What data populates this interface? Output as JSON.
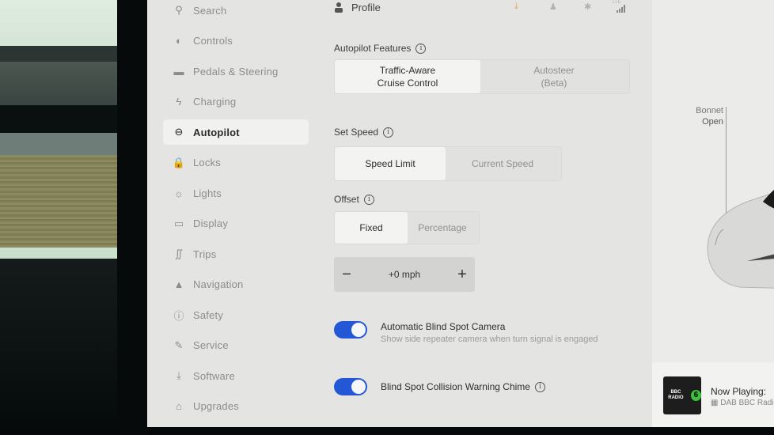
{
  "sidebar": {
    "items": [
      {
        "label": "Search",
        "icon": "search-icon",
        "glyph": "⚲"
      },
      {
        "label": "Controls",
        "icon": "toggle-icon",
        "glyph": "◐"
      },
      {
        "label": "Pedals & Steering",
        "icon": "car-icon",
        "glyph": "▬"
      },
      {
        "label": "Charging",
        "icon": "lightning-icon",
        "glyph": "ϟ"
      },
      {
        "label": "Autopilot",
        "icon": "steering-wheel-icon",
        "glyph": "⊖",
        "active": true
      },
      {
        "label": "Locks",
        "icon": "lock-icon",
        "glyph": "🔒"
      },
      {
        "label": "Lights",
        "icon": "light-icon",
        "glyph": "☼"
      },
      {
        "label": "Display",
        "icon": "display-icon",
        "glyph": "▭"
      },
      {
        "label": "Trips",
        "icon": "trips-icon",
        "glyph": "∬"
      },
      {
        "label": "Navigation",
        "icon": "navigation-icon",
        "glyph": "▲"
      },
      {
        "label": "Safety",
        "icon": "safety-icon",
        "glyph": "ⓘ"
      },
      {
        "label": "Service",
        "icon": "wrench-icon",
        "glyph": "✎"
      },
      {
        "label": "Software",
        "icon": "download-icon",
        "glyph": "⤓"
      },
      {
        "label": "Upgrades",
        "icon": "bag-icon",
        "glyph": "⌂"
      }
    ]
  },
  "header": {
    "profile_label": "Profile",
    "status_icons": [
      "download-icon",
      "bell-icon",
      "bluetooth-icon",
      "lte-signal-icon"
    ],
    "lte_label": "LTE"
  },
  "autopilot_features": {
    "label": "Autopilot Features",
    "options": [
      "Traffic-Aware\nCruise Control",
      "Autosteer\n(Beta)"
    ],
    "selected": 0
  },
  "set_speed": {
    "label": "Set Speed",
    "options": [
      "Speed Limit",
      "Current Speed"
    ],
    "selected": 0
  },
  "offset": {
    "label": "Offset",
    "options": [
      "Fixed",
      "Percentage"
    ],
    "selected": 0,
    "minus": "−",
    "plus": "+",
    "value": "+0 mph"
  },
  "toggles": [
    {
      "title": "Automatic Blind Spot Camera",
      "description": "Show side repeater camera when turn signal is engaged",
      "on": true
    },
    {
      "title": "Blind Spot Collision Warning Chime",
      "description": "",
      "on": true,
      "info": true
    }
  ],
  "vehicle": {
    "bonnet_label": "Bonnet",
    "bonnet_state": "Open"
  },
  "media": {
    "now_playing_label": "Now Playing:",
    "station": "DAB BBC Radio",
    "album_text": "BBC RADIO",
    "album_number": "6",
    "accent": "#3bc23a"
  },
  "colors": {
    "toggle_on": "#2457d6",
    "status_download": "#e8a040"
  }
}
